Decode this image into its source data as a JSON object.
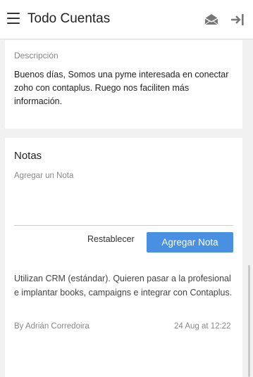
{
  "header": {
    "title": "Todo Cuentas",
    "menu_icon": "hamburger-menu-icon",
    "mail_icon": "open-envelope-icon",
    "exit_icon": "exit-arrow-icon"
  },
  "description": {
    "label": "Descripción",
    "text": "Buenos días,  Somos una pyme interesada en conectar zoho con contaplus. Ruego nos faciliten más información."
  },
  "notes": {
    "title": "Notas",
    "input_placeholder": "Agregar un Nota",
    "reset_label": "Restablecer",
    "add_label": "Agregar Nota",
    "items": [
      {
        "text": "Utilizan CRM (estándar). Quieren pasar a la profesional e implantar books, campaigns e integrar con Contaplus.",
        "author": "By Adrián Corredoira",
        "date": "24 Aug at 12:22"
      }
    ]
  },
  "colors": {
    "accent": "#4a90e2",
    "background": "#f1f1f1"
  }
}
